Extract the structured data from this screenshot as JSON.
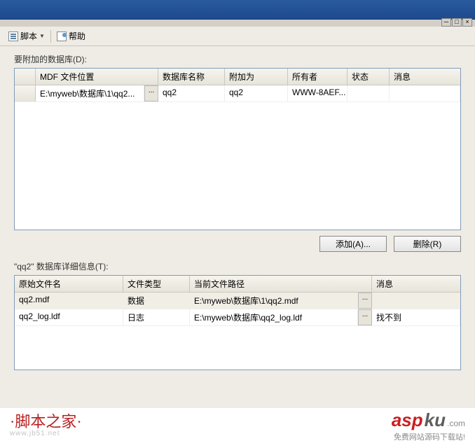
{
  "toolbar": {
    "script_label": "脚本",
    "help_label": "帮助"
  },
  "top_section": {
    "label": "要附加的数据库(D):",
    "headers": {
      "mdf_location": "MDF 文件位置",
      "db_name": "数据库名称",
      "attach_as": "附加为",
      "owner": "所有者",
      "status": "状态",
      "message": "消息"
    },
    "rows": [
      {
        "mdf_location": "E:\\myweb\\数据库\\1\\qq2...",
        "db_name": "qq2",
        "attach_as": "qq2",
        "owner": "WWW-8AEF...",
        "status": "",
        "message": ""
      }
    ]
  },
  "buttons": {
    "add": "添加(A)...",
    "remove": "删除(R)"
  },
  "bottom_section": {
    "label": "\"qq2\" 数据库详细信息(T):",
    "headers": {
      "orig_file": "原始文件名",
      "file_type": "文件类型",
      "current_path": "当前文件路径",
      "message": "消息"
    },
    "rows": [
      {
        "orig_file": "qq2.mdf",
        "file_type": "数据",
        "current_path": "E:\\myweb\\数据库\\1\\qq2.mdf",
        "message": ""
      },
      {
        "orig_file": "qq2_log.ldf",
        "file_type": "日志",
        "current_path": "E:\\myweb\\数据库\\qq2_log.ldf",
        "message": "找不到"
      }
    ]
  },
  "watermark": {
    "left_title": "·脚本之家·",
    "left_url": "www.jb51.net",
    "right_asp": "asp",
    "right_ku": "ku",
    "right_com": ".com",
    "right_sub": "免费网站源码下载站!"
  }
}
